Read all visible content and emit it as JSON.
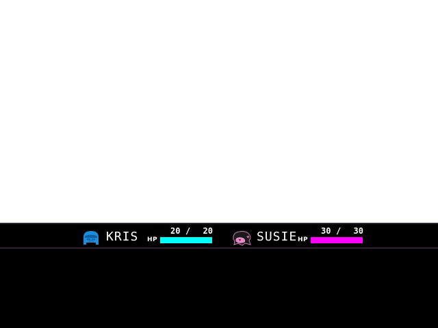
{
  "party": [
    {
      "name": "KRIS",
      "hp_label": "HP",
      "hp_current": "20",
      "hp_separator": "/",
      "hp_max": "20",
      "hp_fraction": 1.0,
      "color": "#00ffff",
      "portrait_icon": "kris-portrait-icon"
    },
    {
      "name": "SUSIE",
      "hp_label": "HP",
      "hp_current": "30",
      "hp_separator": "/",
      "hp_max": "30",
      "hp_fraction": 1.0,
      "color": "#ff00ff",
      "portrait_icon": "susie-portrait-icon"
    }
  ],
  "colors": {
    "hud_background": "#000000",
    "hud_border": "#332033",
    "scene_background": "#ffffff"
  }
}
